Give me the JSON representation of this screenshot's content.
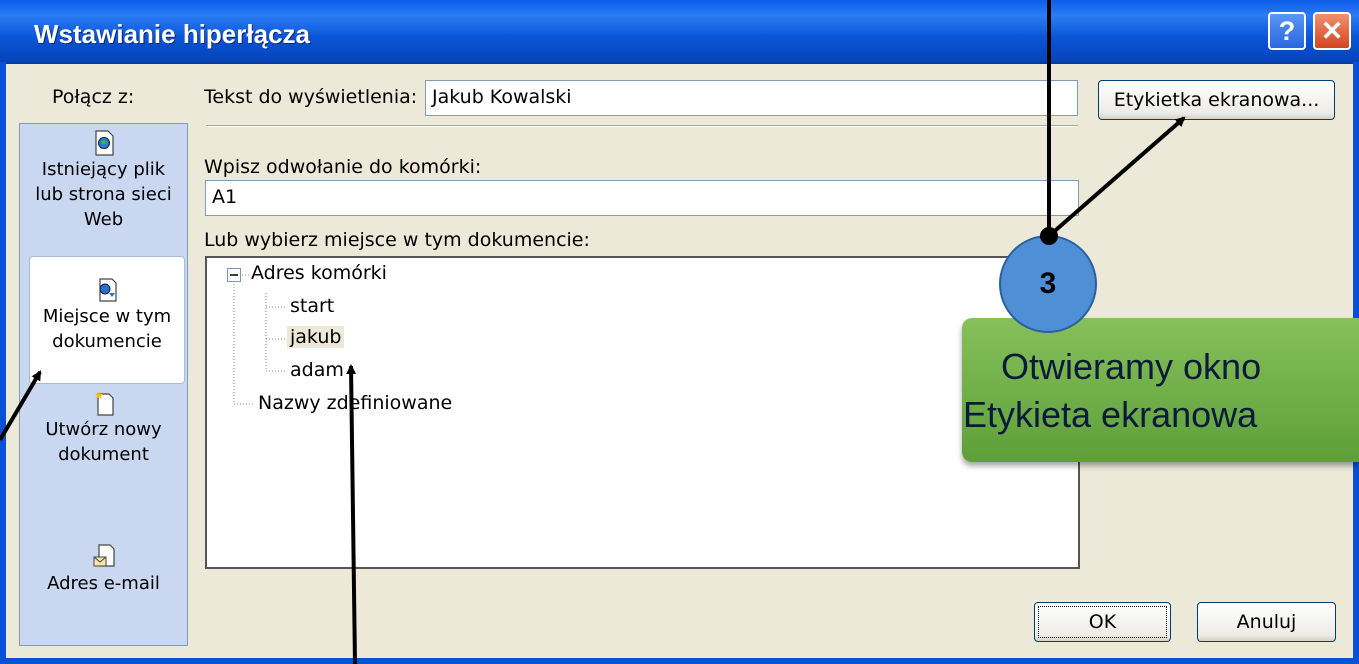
{
  "dialog": {
    "title": "Wstawianie hiperłącza",
    "help_label": "?",
    "close_label": "✕"
  },
  "sidebar": {
    "heading": "Połącz z:",
    "items": [
      {
        "label_lines": [
          "Istniejący plik",
          "lub strona sieci",
          "Web"
        ],
        "icon": "globe-file-icon",
        "selected": false
      },
      {
        "label_lines": [
          "Miejsce w tym",
          "dokumencie"
        ],
        "icon": "document-place-icon",
        "selected": true
      },
      {
        "label_lines": [
          "Utwórz nowy",
          "dokument"
        ],
        "icon": "new-document-icon",
        "selected": false
      },
      {
        "label_lines": [
          "Adres e-mail"
        ],
        "icon": "email-icon",
        "selected": false
      }
    ]
  },
  "form": {
    "display_text_label": "Tekst do wyświetlenia:",
    "display_text_value": "Jakub Kowalski",
    "screentip_button": "Etykietka ekranowa...",
    "cell_ref_label": "Wpisz odwołanie do komórki:",
    "cell_ref_value": "A1",
    "place_label": "Lub wybierz miejsce w tym dokumencie:"
  },
  "tree": {
    "root": "Adres komórki",
    "children": [
      "start",
      "jakub",
      "adam"
    ],
    "selected": "jakub",
    "second_root": "Nazwy zdefiniowane"
  },
  "buttons": {
    "ok": "OK",
    "cancel": "Anuluj"
  },
  "annotation": {
    "badge_number": "3",
    "callout_lines": [
      "Otwieramy okno",
      "Etykieta ekranowa"
    ]
  },
  "colors": {
    "titlebar": "#0a55d8",
    "dialog_bg": "#ece9d8",
    "sidebar_bg": "#c9d8f0",
    "badge": "#4f8fd6",
    "callout": "#6aab44"
  }
}
